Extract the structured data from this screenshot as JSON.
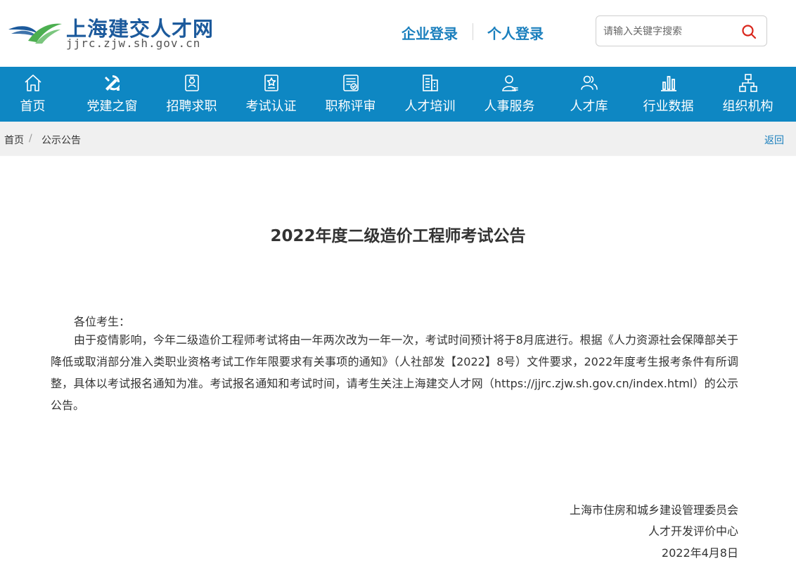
{
  "site": {
    "title": "上海建交人才网",
    "domain": "jjrc.zjw.sh.gov.cn"
  },
  "header": {
    "company_login": "企业登录",
    "person_login": "个人登录",
    "search_placeholder": "请输入关键字搜索"
  },
  "nav": {
    "items": [
      {
        "label": "首页",
        "icon": "home-icon"
      },
      {
        "label": "党建之窗",
        "icon": "party-emblem-icon"
      },
      {
        "label": "招聘求职",
        "icon": "id-badge-icon"
      },
      {
        "label": "考试认证",
        "icon": "certificate-icon"
      },
      {
        "label": "职称评审",
        "icon": "document-check-icon"
      },
      {
        "label": "人才培训",
        "icon": "building-icon"
      },
      {
        "label": "人事服务",
        "icon": "user-icon"
      },
      {
        "label": "人才库",
        "icon": "users-icon"
      },
      {
        "label": "行业数据",
        "icon": "bar-chart-icon"
      },
      {
        "label": "组织机构",
        "icon": "org-chart-icon"
      }
    ]
  },
  "breadcrumb": {
    "home": "首页",
    "separator": "/",
    "current": "公示公告",
    "back": "返回"
  },
  "article": {
    "title": "2022年度二级造价工程师考试公告",
    "greeting": "各位考生：",
    "body": "由于疫情影响，今年二级造价工程师考试将由一年两次改为一年一次，考试时间预计将于8月底进行。根据《人力资源社会保障部关于降低或取消部分准入类职业资格考试工作年限要求有关事项的通知》（人社部发【2022】8号）文件要求，2022年度考生报考条件有所调整，具体以考试报名通知为准。考试报名通知和考试时间，请考生关注上海建交人才网（https://jjrc.zjw.sh.gov.cn/index.html）的公示公告。",
    "signature_org1": "上海市住房和城乡建设管理委员会",
    "signature_org2": "人才开发评价中心",
    "date": "2022年4月8日"
  },
  "colors": {
    "nav_bg": "#0e87c3",
    "brand_blue": "#1c5a9c",
    "link_blue": "#1a7fbd",
    "logo_green": "#4caf50"
  }
}
